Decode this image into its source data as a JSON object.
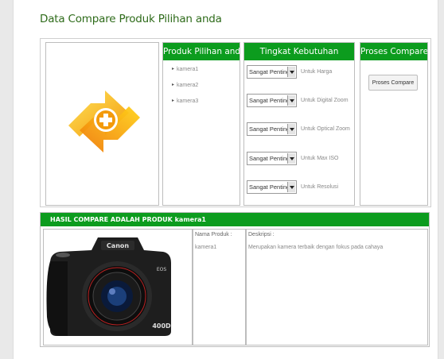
{
  "page": {
    "title": "Data Compare Produk Pilihan anda"
  },
  "products_panel": {
    "header": "Produk Pilihan anda",
    "items": [
      "kamera1",
      "kamera2",
      "kamera3"
    ]
  },
  "needs_panel": {
    "header": "Tingkat Kebutuhan",
    "rows": [
      {
        "selected": "Sangat Penting",
        "label": "Untuk Harga"
      },
      {
        "selected": "Sangat Penting",
        "label": "Untuk Digital Zoom"
      },
      {
        "selected": "Sangat Penting",
        "label": "Untuk Optical Zoom"
      },
      {
        "selected": "Sangat Penting",
        "label": "Untuk Max ISO"
      },
      {
        "selected": "Sangat Penting",
        "label": "Untuk Resolusi"
      }
    ]
  },
  "process_panel": {
    "header": "Proses Compare",
    "button_label": "Proses Compare"
  },
  "result": {
    "header": "HASIL COMPARE ADALAH PRODUK kamera1",
    "name_label": "Nama Produk :",
    "name_value": "kamera1",
    "desc_label": "Deskripsi :",
    "desc_value": "Merupakan kamera terbaik dengan fokus pada cahaya",
    "camera_brand": "Canon",
    "camera_model": "400D",
    "camera_badge": "EOS"
  },
  "colors": {
    "accent": "#0c9c1e",
    "title": "#2e6b1a",
    "arrow_orange": "#f39a0b",
    "arrow_yellow": "#ffd21a"
  },
  "icons": {
    "compare_logo": "orange-swap-arrows-plus-icon",
    "dropdown": "triangle-down-icon",
    "bullet": "right-triangle-bullet-icon"
  }
}
